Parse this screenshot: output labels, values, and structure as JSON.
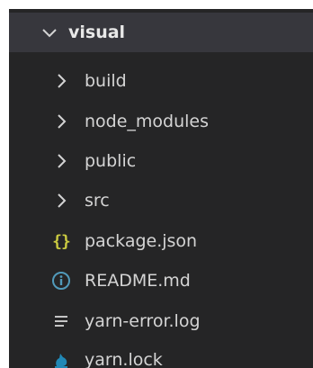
{
  "explorer": {
    "root": {
      "label": "visual",
      "icon": "chevron-down-icon"
    },
    "items": [
      {
        "label": "build",
        "type": "folder",
        "icon": "chevron-right-icon"
      },
      {
        "label": "node_modules",
        "type": "folder",
        "icon": "chevron-right-icon"
      },
      {
        "label": "public",
        "type": "folder",
        "icon": "chevron-right-icon"
      },
      {
        "label": "src",
        "type": "folder",
        "icon": "chevron-right-icon"
      },
      {
        "label": "package.json",
        "type": "file",
        "icon": "json-braces-icon",
        "icon_glyph": "{}",
        "icon_color": "#cbcb41"
      },
      {
        "label": "README.md",
        "type": "file",
        "icon": "info-icon",
        "icon_color": "#519aba"
      },
      {
        "label": "yarn-error.log",
        "type": "file",
        "icon": "log-lines-icon",
        "icon_color": "#c5c5c5"
      },
      {
        "label": "yarn.lock",
        "type": "file",
        "icon": "yarn-cat-icon",
        "icon_color": "#2188b6"
      }
    ]
  },
  "colors": {
    "panel_background": "#252526",
    "selected_row": "#37373d",
    "text": "#d4d4d4"
  }
}
